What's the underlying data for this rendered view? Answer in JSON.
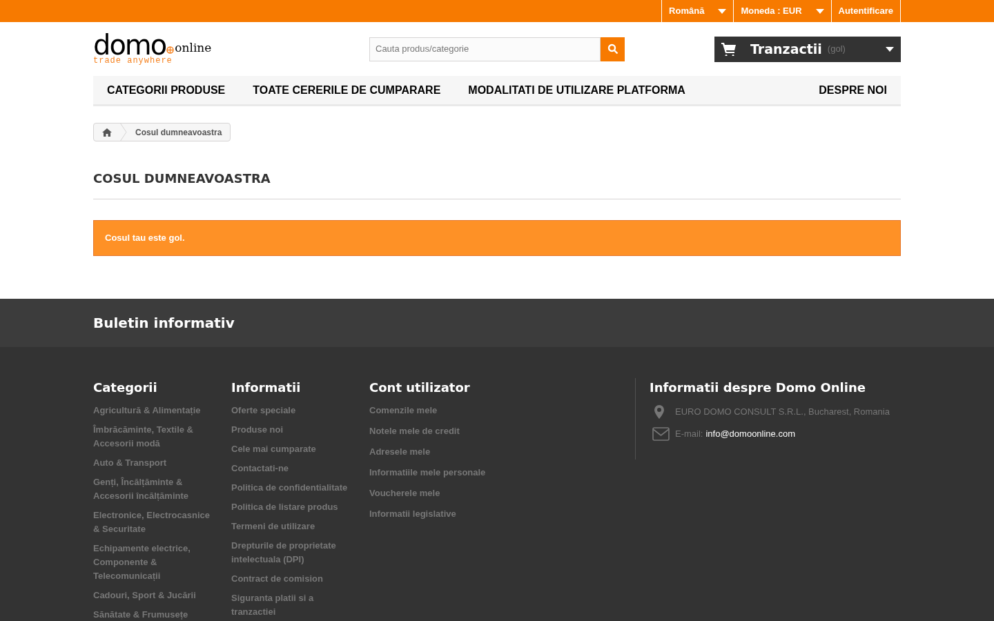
{
  "top_bar": {
    "items": [
      {
        "kind": "dropdown",
        "label": "Română"
      },
      {
        "kind": "dropdown",
        "label": "Moneda : EUR"
      },
      {
        "kind": "link",
        "label": "Autentificare"
      }
    ]
  },
  "logo": {
    "word": "domo",
    "suffix": "online",
    "tagline": "trade anywhere"
  },
  "search": {
    "placeholder": "Cauta produs/categorie"
  },
  "cart": {
    "label": "Tranzactii",
    "status": "(gol)"
  },
  "nav": [
    "CATEGORII PRODUSE",
    "TOATE CERERILE DE CUMPARARE",
    "MODALITATI DE UTILIZARE PLATFORMA",
    "DESPRE NOI"
  ],
  "breadcrumb": {
    "current": "Cosul dumneavoastra"
  },
  "page_title": "COSUL DUMNEAVOASTRA",
  "alert": "Cosul tau este gol.",
  "newsletter": {
    "title": "Buletin informativ"
  },
  "footer": {
    "columns": [
      {
        "title": "Categorii",
        "links": [
          "Agricultură & Alimentație",
          "Îmbrăcăminte, Textile & Accesorii modă",
          "Auto & Transport",
          "Genți, Încălțăminte & Accesorii încălțăminte",
          "Electronice, Electrocasnice & Securitate",
          "Echipamente electrice, Componente & Telecomunicații",
          "Cadouri, Sport & Jucării",
          "Sănătate & Frumusețe"
        ]
      },
      {
        "title": "Informatii",
        "links": [
          "Oferte speciale",
          "Produse noi",
          "Cele mai cumparate",
          "Contactati-ne",
          "Politica de confidentialitate",
          "Politica de listare produs",
          "Termeni de utilizare",
          "Drepturile de proprietate intelectuala (DPI)",
          "Contract de comision",
          "Siguranta platii si a tranzactiei"
        ]
      },
      {
        "title": "Cont utilizator",
        "links": [
          "Comenzile mele",
          "Notele mele de credit",
          "Adresele mele",
          "Informatiile mele personale",
          "Voucherele mele",
          "Informatii legislative"
        ]
      }
    ],
    "contact": {
      "title": "Informatii despre Domo Online",
      "address": "EURO DOMO CONSULT S.R.L., Bucharest, Romania",
      "email_label": "E-mail:",
      "email": "info@domoonline.com"
    }
  }
}
